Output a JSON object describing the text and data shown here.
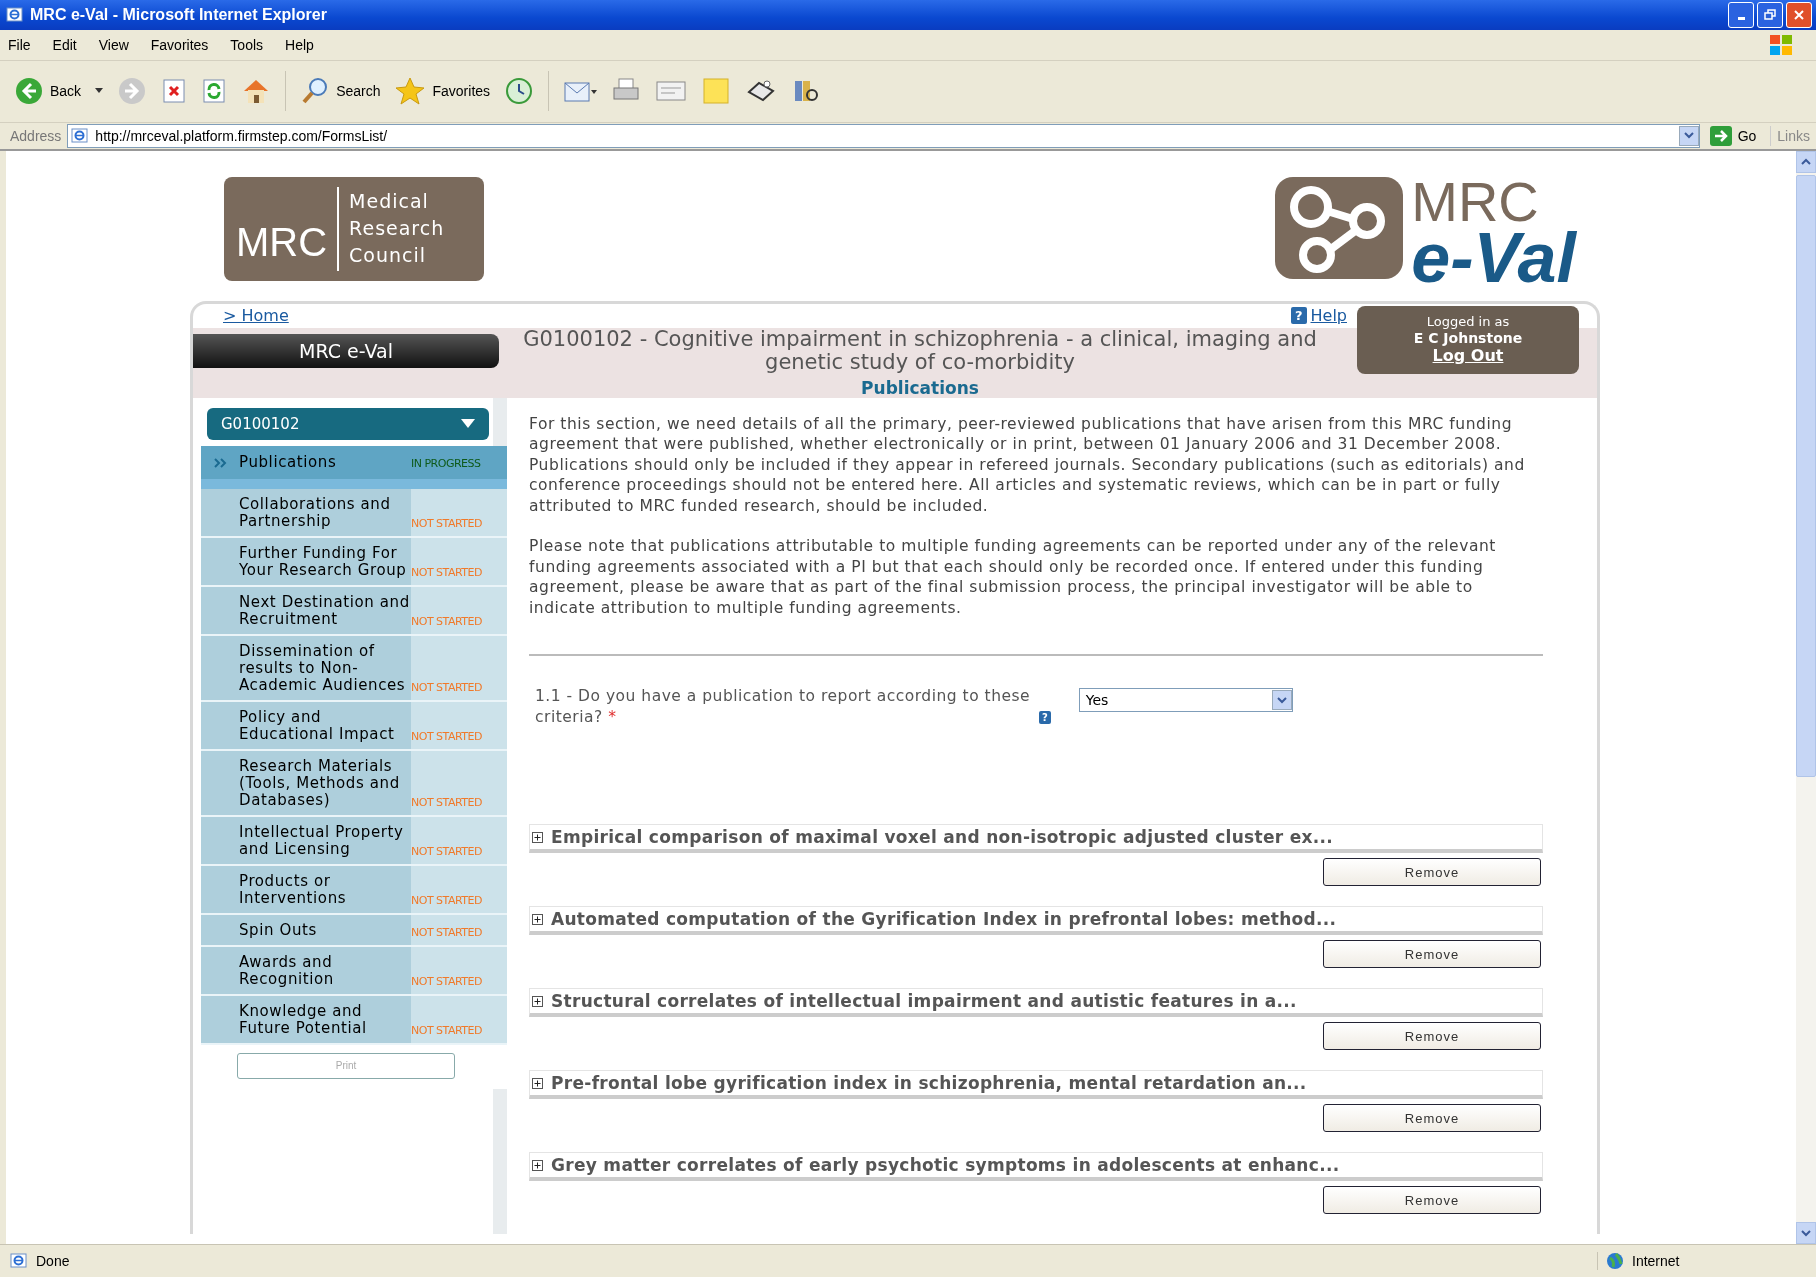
{
  "window": {
    "title": "MRC e-Val - Microsoft Internet Explorer"
  },
  "menu": [
    "File",
    "Edit",
    "View",
    "Favorites",
    "Tools",
    "Help"
  ],
  "toolbar": {
    "back": "Back",
    "search": "Search",
    "favorites": "Favorites"
  },
  "address_bar": {
    "label": "Address",
    "url": "http://mrceval.platform.firmstep.com/FormsList/",
    "go": "Go",
    "links": "Links"
  },
  "page": {
    "logo": {
      "abbr": "MRC",
      "name_lines": [
        "Medical",
        "Research",
        "Council"
      ]
    },
    "product_logo": {
      "line1": "MRC",
      "line2": "e-Val"
    },
    "breadcrumb": "> Home",
    "help_icon": "?",
    "help": "Help",
    "app_name": "MRC e-Val",
    "title": "G0100102 - Cognitive impairment in schizophrenia - a clinical, imaging and genetic study of co-morbidity",
    "section": "Publications",
    "user": {
      "label": "Logged in as",
      "name": "E C Johnstone",
      "logout": "Log Out"
    },
    "agreement_select": "G0100102",
    "sidebar": {
      "items": [
        {
          "label": "Publications",
          "status": "IN PROGRESS",
          "color": "#0e5a1a",
          "selected": true
        },
        {
          "label": "Collaborations and Partnership",
          "status": "NOT STARTED",
          "color": "#f07a2a",
          "selected": false
        },
        {
          "label": "Further Funding For Your Research Group",
          "status": "NOT STARTED",
          "color": "#f07a2a",
          "selected": false
        },
        {
          "label": "Next Destination and Recruitment",
          "status": "NOT STARTED",
          "color": "#f07a2a",
          "selected": false
        },
        {
          "label": "Dissemination of results to Non-Academic Audiences",
          "status": "NOT STARTED",
          "color": "#f07a2a",
          "selected": false
        },
        {
          "label": "Policy and Educational Impact",
          "status": "NOT STARTED",
          "color": "#f07a2a",
          "selected": false
        },
        {
          "label": "Research Materials (Tools, Methods and Databases)",
          "status": "NOT STARTED",
          "color": "#f07a2a",
          "selected": false
        },
        {
          "label": "Intellectual Property and Licensing",
          "status": "NOT STARTED",
          "color": "#f07a2a",
          "selected": false
        },
        {
          "label": "Products or Interventions",
          "status": "NOT STARTED",
          "color": "#f07a2a",
          "selected": false
        },
        {
          "label": "Spin Outs",
          "status": "NOT STARTED",
          "color": "#f07a2a",
          "selected": false
        },
        {
          "label": "Awards and Recognition",
          "status": "NOT STARTED",
          "color": "#f07a2a",
          "selected": false
        },
        {
          "label": "Knowledge and Future Potential",
          "status": "NOT STARTED",
          "color": "#f07a2a",
          "selected": false
        }
      ],
      "print": "Print"
    },
    "paragraphs": [
      "For this section, we need details of all the primary, peer-reviewed publications that have arisen from this MRC funding agreement that were published, whether electronically or in print, between 01 January 2006 and 31 December 2008. Publications should only be included if they appear in refereed journals. Secondary publications (such as editorials) and conference proceedings should not be entered here. All articles and systematic reviews, which can be in part or fully attributed to MRC funded research, should be included.",
      "Please note that publications attributable to multiple funding agreements can be reported under any of the relevant funding agreements associated with a PI but that each should only be recorded once. If entered under this funding agreement, please be aware that as part of the final submission process, the principal investigator will be able to indicate attribution to multiple funding agreements."
    ],
    "question": {
      "label": "1.1 - Do you have a publication to report according to these criteria?",
      "required": "*",
      "help_icon": "?",
      "answer": "Yes"
    },
    "publications": [
      {
        "title": "Empirical comparison of maximal voxel and non-isotropic adjusted cluster ex...",
        "expanded": false,
        "remove": "Remove"
      },
      {
        "title": "Automated computation of the Gyrification Index in prefrontal lobes: method...",
        "expanded": false,
        "remove": "Remove"
      },
      {
        "title": "Structural correlates of intellectual impairment and autistic features in a...",
        "expanded": false,
        "remove": "Remove"
      },
      {
        "title": "Pre-frontal lobe gyrification index in schizophrenia, mental retardation an...",
        "expanded": false,
        "remove": "Remove"
      },
      {
        "title": "Grey matter correlates of early psychotic symptoms in adolescents at enhanc...",
        "expanded": false,
        "remove": "Remove"
      }
    ]
  },
  "status_bar": {
    "text": "Done",
    "zone": "Internet"
  }
}
